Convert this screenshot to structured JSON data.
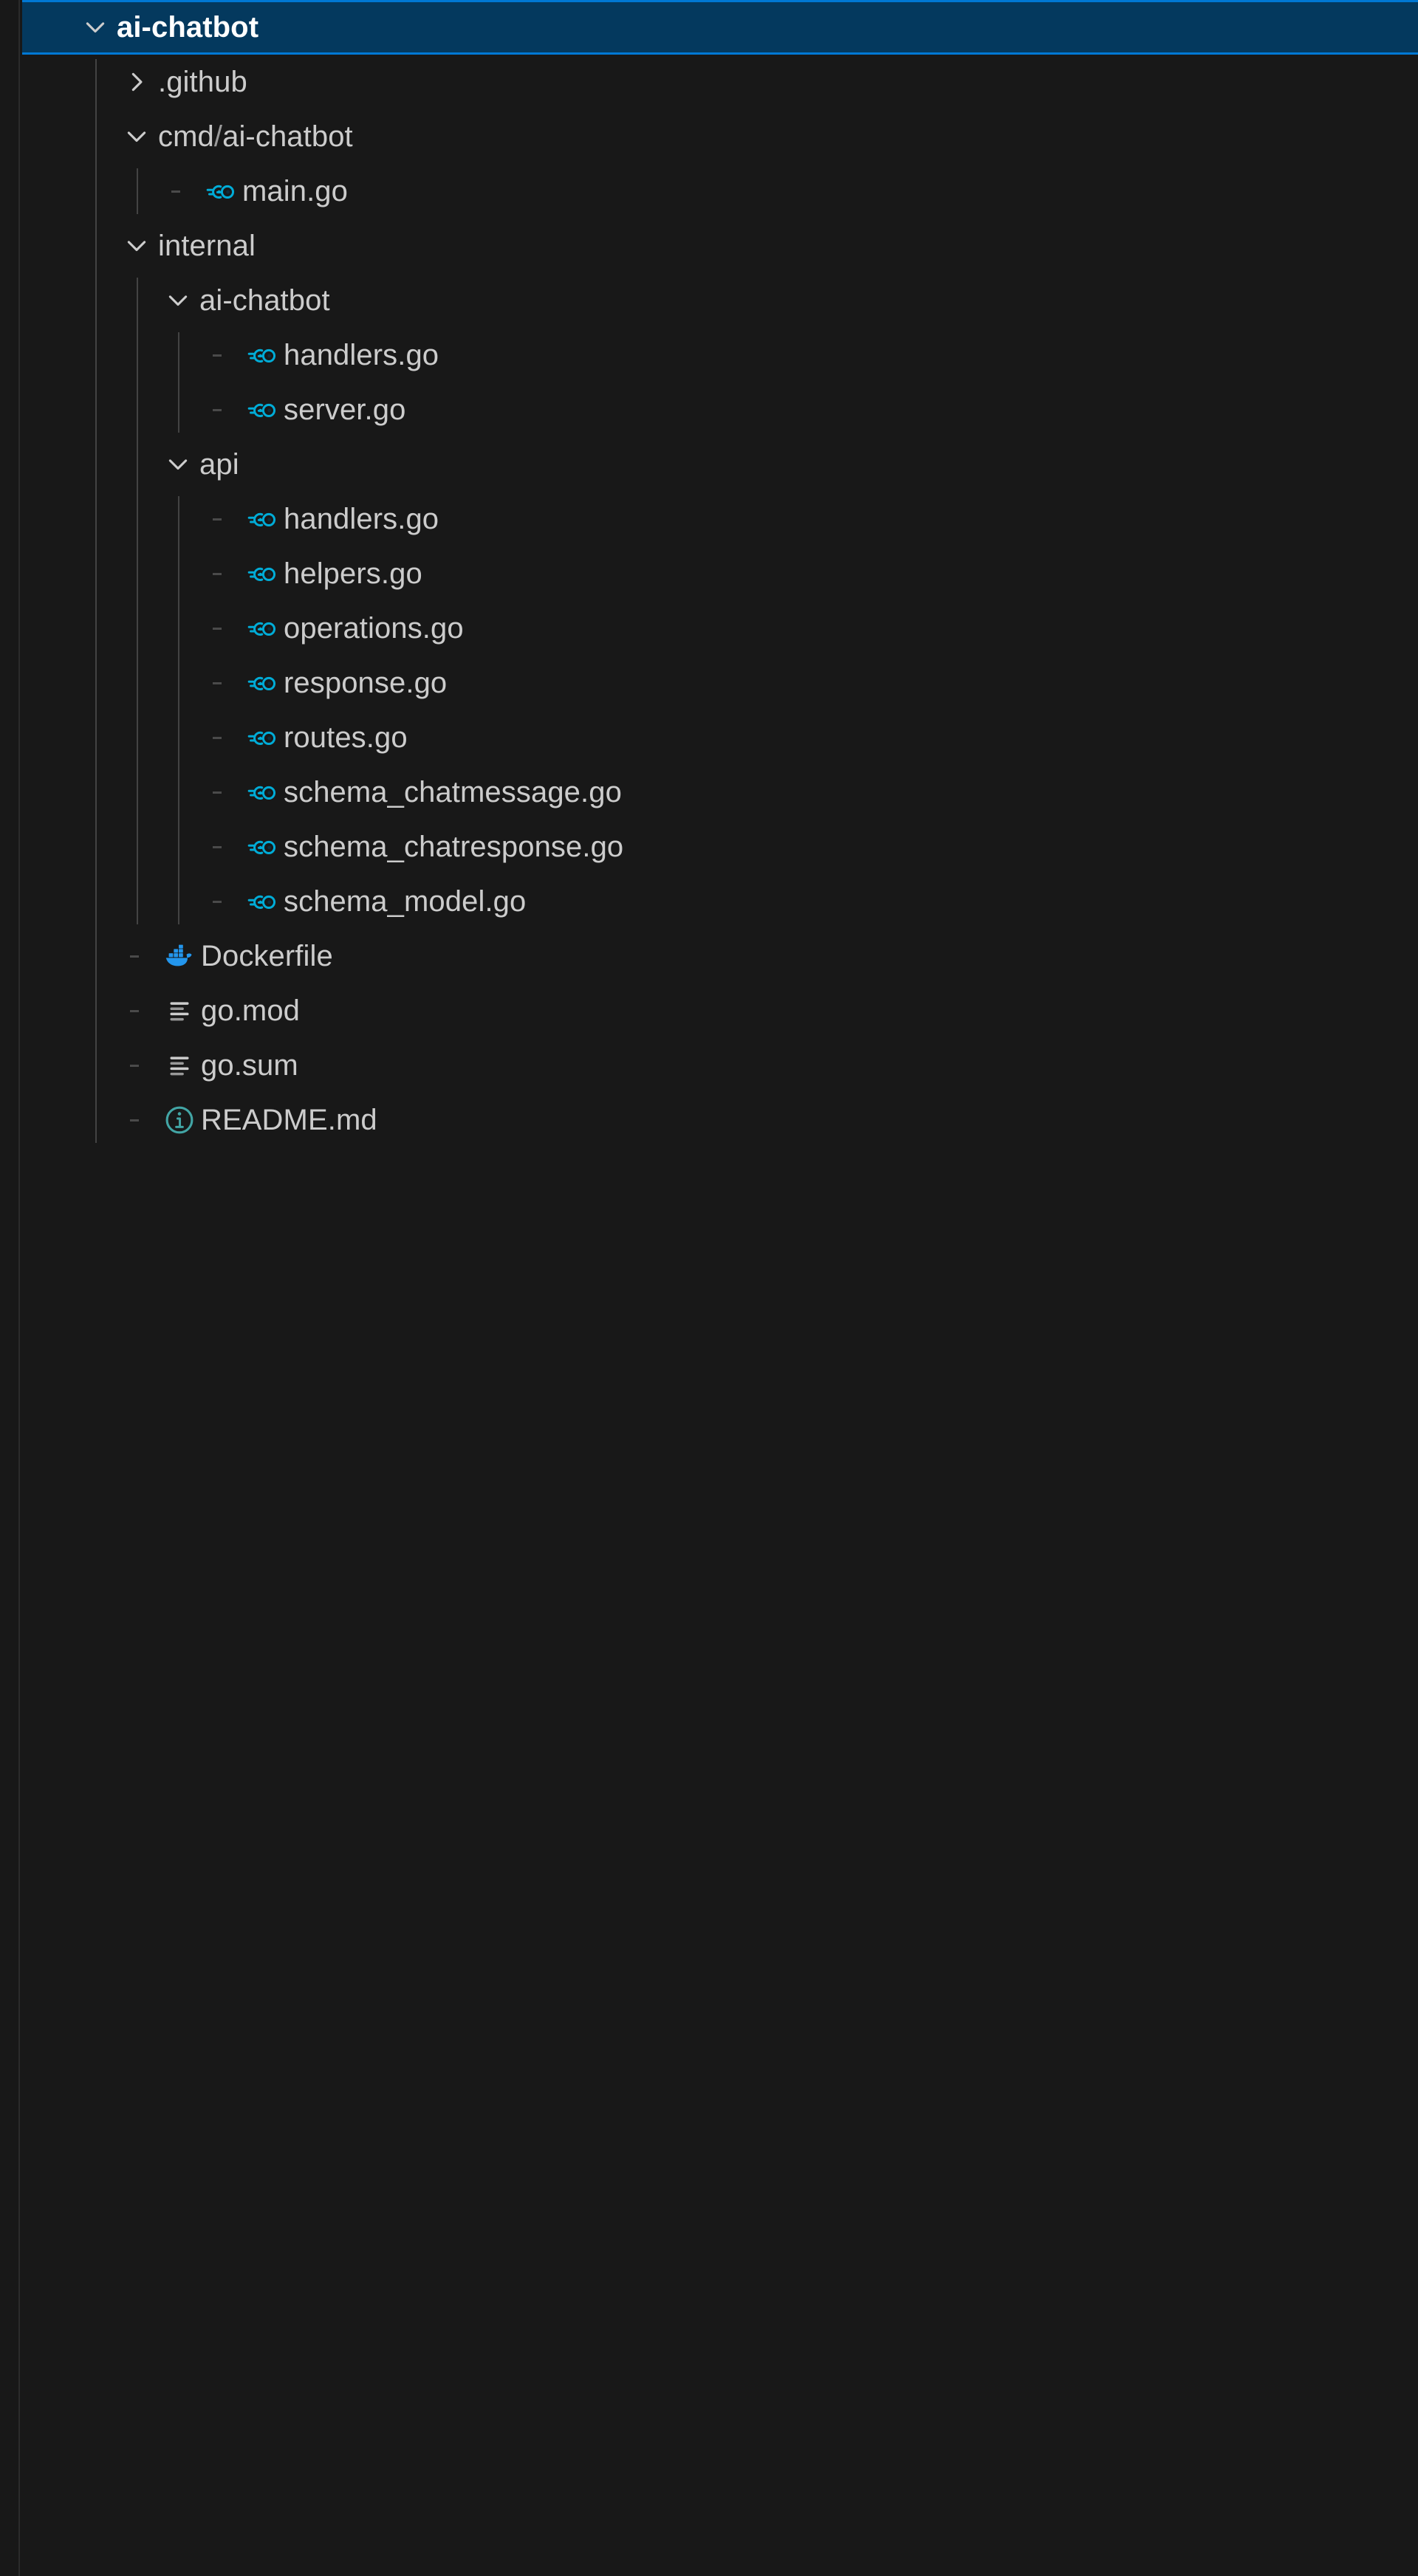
{
  "explorer": {
    "theme": {
      "background": "#181818",
      "selected_background": "#04395e",
      "selected_border": "#0078d4",
      "text": "#cccccc",
      "selected_text": "#ffffff",
      "indent_guide": "#434343",
      "go_icon_color": "#00acd7",
      "docker_icon_color": "#2396ed",
      "readme_icon_color": "#42a5a5"
    },
    "rows": [
      {
        "label": "ai-chatbot",
        "kind": "folder",
        "icon": "none",
        "state": "expanded",
        "indent": 0,
        "selected": true
      },
      {
        "label": ".github",
        "kind": "folder",
        "icon": "none",
        "state": "collapsed",
        "indent": 1,
        "selected": false
      },
      {
        "label": "cmd/ai-chatbot",
        "kind": "folder",
        "icon": "none",
        "state": "expanded",
        "indent": 1,
        "selected": false,
        "separator": "/"
      },
      {
        "label": "main.go",
        "kind": "file",
        "icon": "go-icon",
        "state": "none",
        "indent": 2,
        "selected": false
      },
      {
        "label": "internal",
        "kind": "folder",
        "icon": "none",
        "state": "expanded",
        "indent": 1,
        "selected": false
      },
      {
        "label": "ai-chatbot",
        "kind": "folder",
        "icon": "none",
        "state": "expanded",
        "indent": 2,
        "selected": false
      },
      {
        "label": "handlers.go",
        "kind": "file",
        "icon": "go-icon",
        "state": "none",
        "indent": 3,
        "selected": false
      },
      {
        "label": "server.go",
        "kind": "file",
        "icon": "go-icon",
        "state": "none",
        "indent": 3,
        "selected": false
      },
      {
        "label": "api",
        "kind": "folder",
        "icon": "none",
        "state": "expanded",
        "indent": 2,
        "selected": false
      },
      {
        "label": "handlers.go",
        "kind": "file",
        "icon": "go-icon",
        "state": "none",
        "indent": 3,
        "selected": false
      },
      {
        "label": "helpers.go",
        "kind": "file",
        "icon": "go-icon",
        "state": "none",
        "indent": 3,
        "selected": false
      },
      {
        "label": "operations.go",
        "kind": "file",
        "icon": "go-icon",
        "state": "none",
        "indent": 3,
        "selected": false
      },
      {
        "label": "response.go",
        "kind": "file",
        "icon": "go-icon",
        "state": "none",
        "indent": 3,
        "selected": false
      },
      {
        "label": "routes.go",
        "kind": "file",
        "icon": "go-icon",
        "state": "none",
        "indent": 3,
        "selected": false
      },
      {
        "label": "schema_chatmessage.go",
        "kind": "file",
        "icon": "go-icon",
        "state": "none",
        "indent": 3,
        "selected": false
      },
      {
        "label": "schema_chatresponse.go",
        "kind": "file",
        "icon": "go-icon",
        "state": "none",
        "indent": 3,
        "selected": false
      },
      {
        "label": "schema_model.go",
        "kind": "file",
        "icon": "go-icon",
        "state": "none",
        "indent": 3,
        "selected": false
      },
      {
        "label": "Dockerfile",
        "kind": "file",
        "icon": "docker-icon",
        "state": "none",
        "indent": 1,
        "selected": false
      },
      {
        "label": "go.mod",
        "kind": "file",
        "icon": "text-lines-icon",
        "state": "none",
        "indent": 1,
        "selected": false
      },
      {
        "label": "go.sum",
        "kind": "file",
        "icon": "text-lines-icon",
        "state": "none",
        "indent": 1,
        "selected": false
      },
      {
        "label": "README.md",
        "kind": "file",
        "icon": "info-icon",
        "state": "none",
        "indent": 1,
        "selected": false
      }
    ]
  }
}
